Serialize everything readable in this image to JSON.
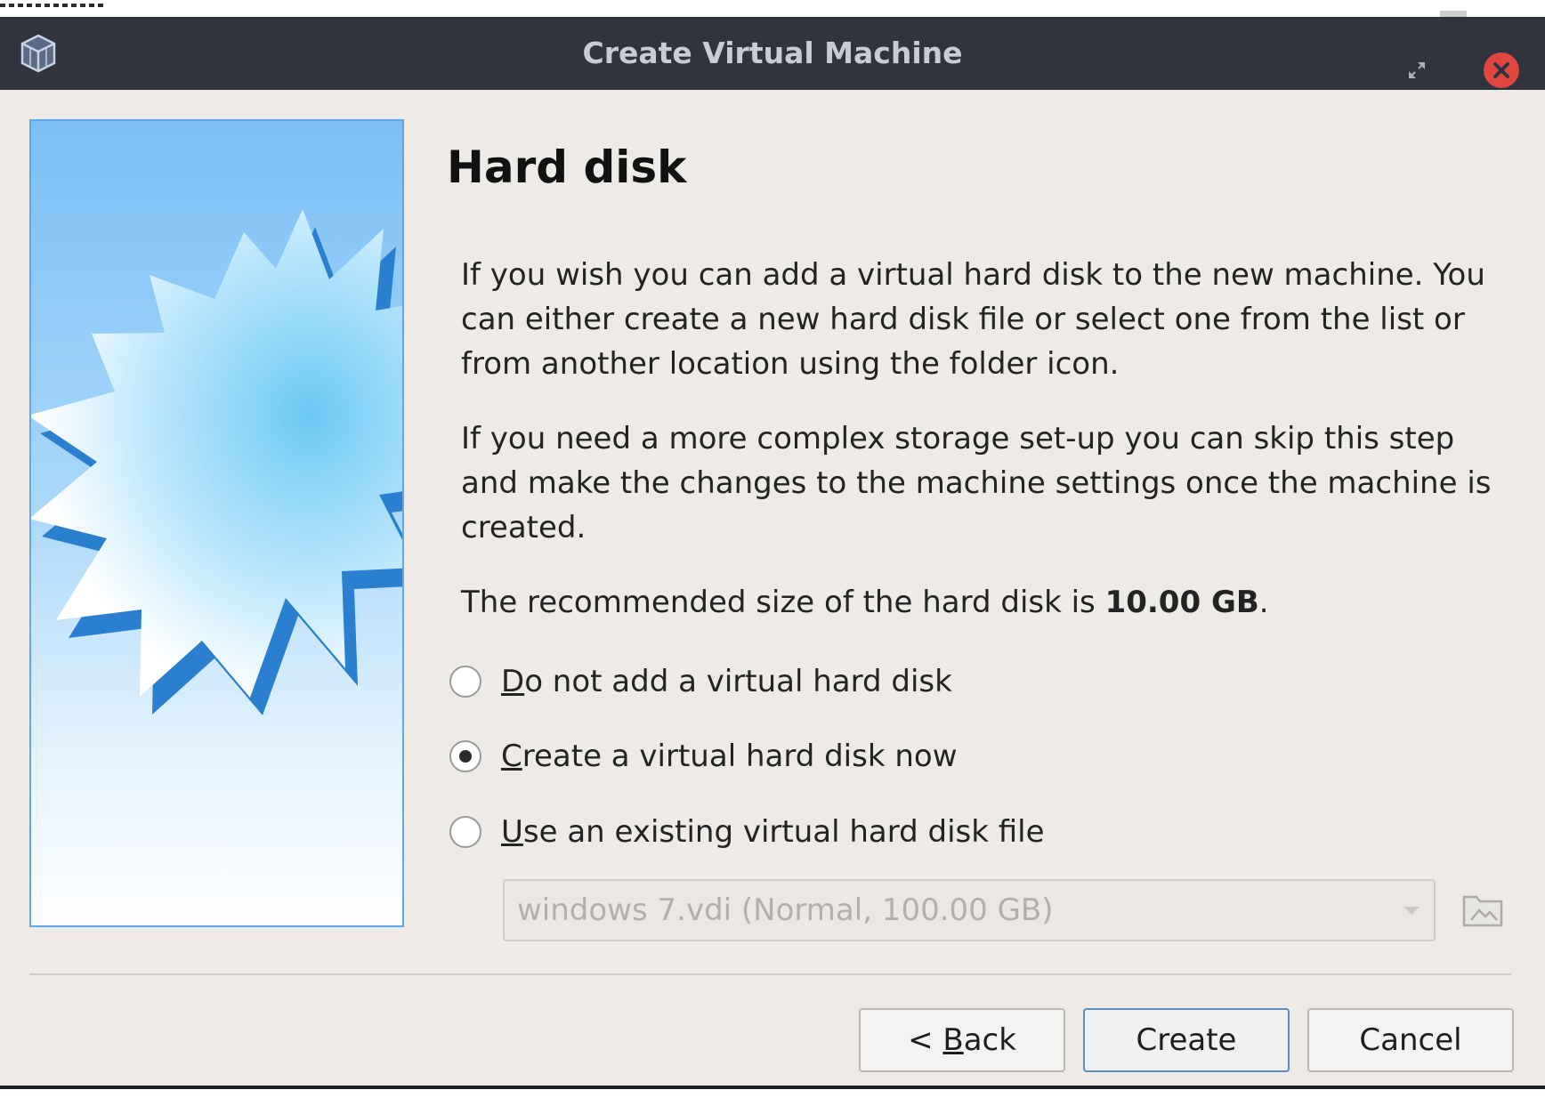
{
  "window": {
    "title": "Create Virtual Machine",
    "icons": {
      "app": "virtualbox-icon",
      "restore": "restore-icon",
      "close": "close-icon"
    },
    "accent_close": "#e0453f"
  },
  "page": {
    "heading": "Hard disk",
    "para1": "If you wish you can add a virtual hard disk to the new machine. You can either create a new hard disk file or select one from the list or from another location using the folder icon.",
    "para2": "If you need a more complex storage set-up you can skip this step and make the changes to the machine settings once the machine is created.",
    "para3_prefix": "The recommended size of the hard disk is ",
    "para3_size": "10.00 GB",
    "para3_suffix": "."
  },
  "options": [
    {
      "mnemonic": "D",
      "rest": "o not add a virtual hard disk",
      "checked": false
    },
    {
      "mnemonic": "C",
      "rest": "reate a virtual hard disk now",
      "checked": true
    },
    {
      "mnemonic": "U",
      "rest": "se an existing virtual hard disk file",
      "checked": false
    }
  ],
  "disk_select": {
    "value": "windows 7.vdi (Normal, 100.00 GB)",
    "enabled": false,
    "icons": {
      "arrow": "chevron-down-icon",
      "folder": "folder-icon"
    }
  },
  "buttons": {
    "back_prefix": "< ",
    "back_mnemonic": "B",
    "back_rest": "ack",
    "create": "Create",
    "cancel": "Cancel"
  }
}
